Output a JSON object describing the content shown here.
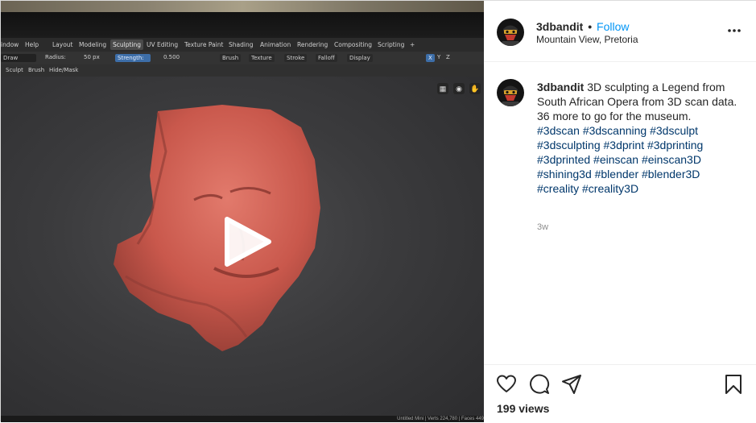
{
  "post": {
    "username": "3dbandit",
    "separator": "•",
    "follow_label": "Follow",
    "location": "Mountain View, Pretoria",
    "caption_lines": [
      "3D sculpting a Legend from South African Opera from 3D scan data.",
      "36 more to go for the museum."
    ],
    "hashtags": "#3dscan #3dscanning #3dsculpt #3dsculpting #3dprint #3dprinting #3dprinted #einscan #einscan3D #shining3d #blender #blender3D #creality #creality3D",
    "time_ago": "3w",
    "views": "199 views"
  },
  "icons": {
    "more": "more-horizontal-icon",
    "like": "heart-icon",
    "comment": "comment-icon",
    "share": "paper-plane-icon",
    "save": "bookmark-icon",
    "play": "play-icon"
  },
  "video": {
    "blender_menu": [
      "indow",
      "Help"
    ],
    "workspaces": [
      "Layout",
      "Modeling",
      "Sculpting",
      "UV Editing",
      "Texture Paint",
      "Shading",
      "Animation",
      "Rendering",
      "Compositing",
      "Scripting",
      "+"
    ],
    "active_workspace": "Sculpting",
    "toolbar": {
      "tool": "Draw",
      "radius_label": "Radius:",
      "radius_value": "50 px",
      "strength_label": "Strength:",
      "strength_value": "0.500",
      "dropdowns": [
        "Brush",
        "Texture",
        "Stroke",
        "Falloff",
        "Display"
      ],
      "axes": [
        "X",
        "Y",
        "Z"
      ]
    },
    "header_menu": [
      "Sculpt",
      "Brush",
      "Hide/Mask"
    ],
    "status_text": "Untitled Mini | Verts 224,780 | Faces 449"
  },
  "colors": {
    "link": "#0095f6",
    "hashtag": "#00376b",
    "text": "#262626",
    "muted": "#8e8e8e",
    "sculpt": "#c9584c"
  }
}
